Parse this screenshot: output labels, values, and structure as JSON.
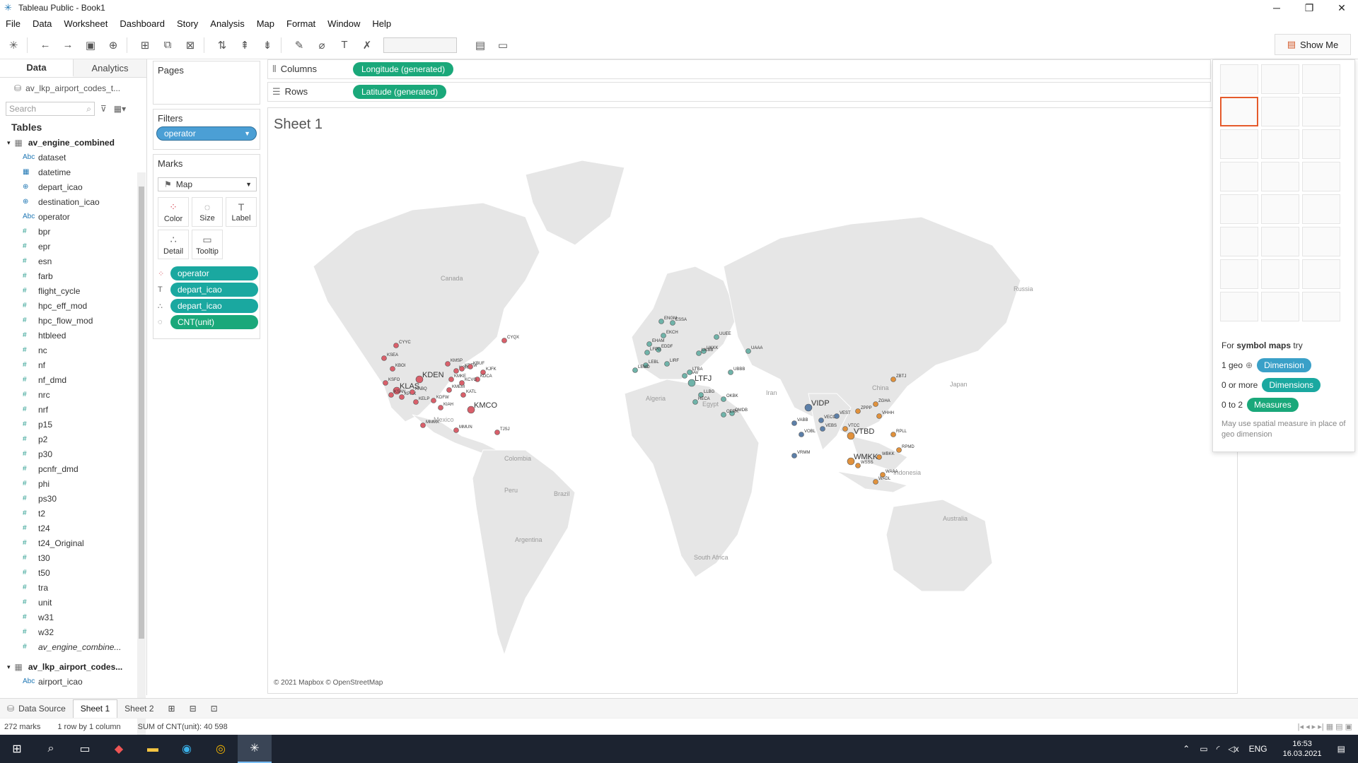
{
  "window": {
    "title": "Tableau Public - Book1"
  },
  "menu": [
    "File",
    "Data",
    "Worksheet",
    "Dashboard",
    "Story",
    "Analysis",
    "Map",
    "Format",
    "Window",
    "Help"
  ],
  "toolbar": {
    "show_me_label": "Show Me"
  },
  "left_pane": {
    "tab_data": "Data",
    "tab_analytics": "Analytics",
    "datasource": "av_lkp_airport_codes_t...",
    "search_placeholder": "Search",
    "tables_heading": "Tables",
    "table1": "av_engine_combined",
    "fields": [
      {
        "type": "Abc",
        "name": "dataset"
      },
      {
        "type": "date",
        "name": "datetime"
      },
      {
        "type": "geo",
        "name": "depart_icao"
      },
      {
        "type": "geo",
        "name": "destination_icao"
      },
      {
        "type": "Abc",
        "name": "operator"
      },
      {
        "type": "#",
        "name": "bpr"
      },
      {
        "type": "#",
        "name": "epr"
      },
      {
        "type": "#",
        "name": "esn"
      },
      {
        "type": "#",
        "name": "farb"
      },
      {
        "type": "#",
        "name": "flight_cycle"
      },
      {
        "type": "#",
        "name": "hpc_eff_mod"
      },
      {
        "type": "#",
        "name": "hpc_flow_mod"
      },
      {
        "type": "#",
        "name": "htbleed"
      },
      {
        "type": "#",
        "name": "nc"
      },
      {
        "type": "#",
        "name": "nf"
      },
      {
        "type": "#",
        "name": "nf_dmd"
      },
      {
        "type": "#",
        "name": "nrc"
      },
      {
        "type": "#",
        "name": "nrf"
      },
      {
        "type": "#",
        "name": "p15"
      },
      {
        "type": "#",
        "name": "p2"
      },
      {
        "type": "#",
        "name": "p30"
      },
      {
        "type": "#",
        "name": "pcnfr_dmd"
      },
      {
        "type": "#",
        "name": "phi"
      },
      {
        "type": "#",
        "name": "ps30"
      },
      {
        "type": "#",
        "name": "t2"
      },
      {
        "type": "#",
        "name": "t24"
      },
      {
        "type": "#",
        "name": "t24_Original"
      },
      {
        "type": "#",
        "name": "t30"
      },
      {
        "type": "#",
        "name": "t50"
      },
      {
        "type": "#",
        "name": "tra"
      },
      {
        "type": "#",
        "name": "unit"
      },
      {
        "type": "#",
        "name": "w31"
      },
      {
        "type": "#",
        "name": "w32"
      },
      {
        "type": "#",
        "name": "av_engine_combine..."
      }
    ],
    "table2": "av_lkp_airport_codes...",
    "table2_field": "airport_icao"
  },
  "pages": {
    "label": "Pages"
  },
  "filters": {
    "label": "Filters",
    "pill": "operator"
  },
  "marks": {
    "label": "Marks",
    "type": "Map",
    "buttons": [
      "Color",
      "Size",
      "Label",
      "Detail",
      "Tooltip"
    ],
    "pills": [
      "operator",
      "depart_icao",
      "depart_icao",
      "CNT(unit)"
    ]
  },
  "shelves": {
    "columns_label": "Columns",
    "columns_pill": "Longitude (generated)",
    "rows_label": "Rows",
    "rows_pill": "Latitude (generated)"
  },
  "sheet": {
    "title": "Sheet 1",
    "attribution": "© 2021 Mapbox © OpenStreetMap"
  },
  "map_labels": {
    "regions": [
      "Canada",
      "Russia",
      "Algeria",
      "Egypt",
      "Iran",
      "China",
      "Japan",
      "Mexico",
      "Colombia",
      "Peru",
      "Brazil",
      "Argentina",
      "South Africa",
      "Australia",
      "Indonesia"
    ],
    "airports": [
      {
        "code": "KDEN",
        "big": true
      },
      {
        "code": "KLAS",
        "big": true
      },
      {
        "code": "KMCO",
        "big": true
      },
      {
        "code": "CYYC"
      },
      {
        "code": "CYQX"
      },
      {
        "code": "KSEA"
      },
      {
        "code": "KBOI"
      },
      {
        "code": "KSFO"
      },
      {
        "code": "KSAN"
      },
      {
        "code": "KPHX"
      },
      {
        "code": "KABQ"
      },
      {
        "code": "KELP"
      },
      {
        "code": "KMSP"
      },
      {
        "code": "KORD"
      },
      {
        "code": "KDTW"
      },
      {
        "code": "KBUF"
      },
      {
        "code": "KJFK"
      },
      {
        "code": "KDCA"
      },
      {
        "code": "KATL"
      },
      {
        "code": "KMEM"
      },
      {
        "code": "KDFW"
      },
      {
        "code": "KIAH"
      },
      {
        "code": "KCVG"
      },
      {
        "code": "KMKE"
      },
      {
        "code": "MMMX"
      },
      {
        "code": "MMUN"
      },
      {
        "code": "TJSJ"
      },
      {
        "code": "LTFJ",
        "big": true
      },
      {
        "code": "ENGM"
      },
      {
        "code": "ESSA"
      },
      {
        "code": "EKCH"
      },
      {
        "code": "EHAM"
      },
      {
        "code": "EDDF"
      },
      {
        "code": "LFPG"
      },
      {
        "code": "LEBL"
      },
      {
        "code": "LEMD"
      },
      {
        "code": "LIRF"
      },
      {
        "code": "LGAV"
      },
      {
        "code": "UUEE"
      },
      {
        "code": "UKKK"
      },
      {
        "code": "UKBB"
      },
      {
        "code": "LTBA"
      },
      {
        "code": "LLBG"
      },
      {
        "code": "HECA"
      },
      {
        "code": "OMDB"
      },
      {
        "code": "OKBK"
      },
      {
        "code": "OERK"
      },
      {
        "code": "UBBB"
      },
      {
        "code": "UAAA"
      },
      {
        "code": "VIDP",
        "big": true
      },
      {
        "code": "VABB"
      },
      {
        "code": "VOBL"
      },
      {
        "code": "VRMM"
      },
      {
        "code": "VECC"
      },
      {
        "code": "VEBS"
      },
      {
        "code": "VEST"
      },
      {
        "code": "VTBD",
        "big": true
      },
      {
        "code": "WMKK",
        "big": true
      },
      {
        "code": "VHHH"
      },
      {
        "code": "ZGHA"
      },
      {
        "code": "ZPPP"
      },
      {
        "code": "ZBTJ"
      },
      {
        "code": "VTCC"
      },
      {
        "code": "RPLL"
      },
      {
        "code": "RPMD"
      },
      {
        "code": "WSSS"
      },
      {
        "code": "WAAA"
      },
      {
        "code": "WADL"
      },
      {
        "code": "WBKK"
      }
    ]
  },
  "show_me": {
    "hint_prefix": "For",
    "hint_bold": "symbol maps",
    "hint_suffix": "try",
    "req1": "1 geo",
    "req1_pill": "Dimension",
    "req2": "0 or more",
    "req2_pill": "Dimensions",
    "req3": "0 to 2",
    "req3_pill": "Measures",
    "note": "May use spatial measure in place of geo dimension"
  },
  "bottom_tabs": {
    "data_source": "Data Source",
    "sheet1": "Sheet 1",
    "sheet2": "Sheet 2"
  },
  "status": {
    "marks": "272 marks",
    "rows_cols": "1 row by 1 column",
    "sum": "SUM of CNT(unit): 40 598"
  },
  "taskbar": {
    "time": "16:53",
    "date": "16.03.2021",
    "lang": "ENG"
  },
  "colors": {
    "teal_pill": "#1aa8a0",
    "green_pill": "#1aa87a",
    "us_marks": "#d95f6a",
    "europe_marks": "#6fb3a9",
    "india_marks": "#5c7fa8",
    "asia_marks": "#e0913c"
  }
}
